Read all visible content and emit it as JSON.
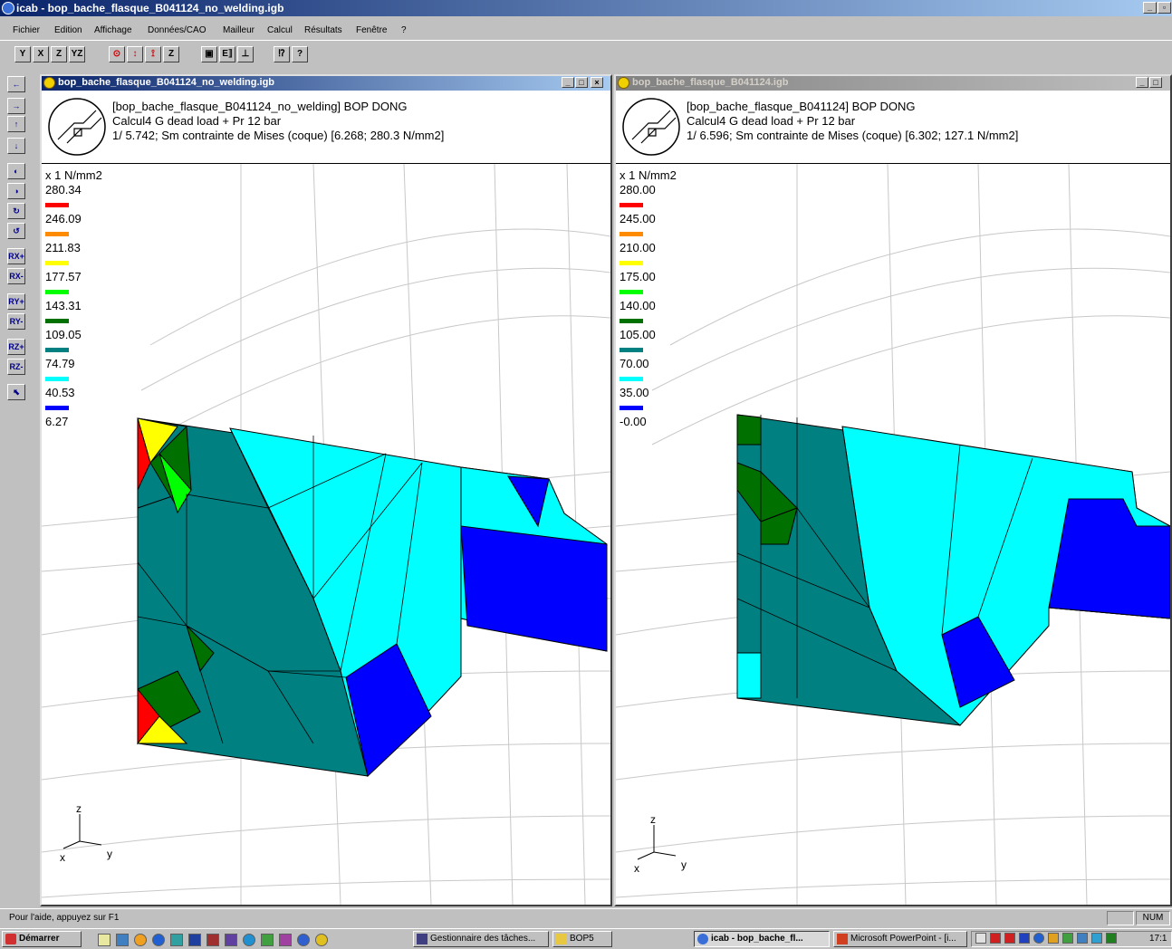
{
  "app": {
    "title": "icab - bop_bache_flasque_B041124_no_welding.igb",
    "menu": [
      "Fichier",
      "Edition",
      "Affichage",
      "Données/CAO",
      "Mailleur",
      "Calcul",
      "Résultats",
      "Fenêtre",
      "?"
    ]
  },
  "toolbar": {
    "buttons": [
      "Y",
      "X",
      "Z",
      "YZ",
      "⊙",
      "↕",
      "⟟",
      "Z",
      "▣",
      "E⟧",
      "⊥",
      "⁉",
      "?"
    ]
  },
  "left_toolbar": {
    "buttons": [
      "←",
      "→",
      "↑",
      "↓",
      "◐",
      "◑",
      "↻",
      "↺",
      "RX+",
      "RX-",
      "RY+",
      "RY-",
      "RZ+",
      "RZ-",
      "⬉"
    ]
  },
  "windows": [
    {
      "title": "bop_bache_flasque_B041124_no_welding.igb",
      "line1": "[bop_bache_flasque_B041124_no_welding] BOP DONG",
      "line2": "Calcul4 G dead load + Pr 12 bar",
      "line3": "1/ 5.742; Sm  contrainte de Mises (coque) [6.268; 280.3 N/mm2]",
      "unit": "x 1 N/mm2",
      "levels": [
        "280.34",
        "246.09",
        "211.83",
        "177.57",
        "143.31",
        "109.05",
        "74.79",
        "40.53",
        "6.27"
      ],
      "axes": {
        "z": "z",
        "x": "x",
        "y": "y"
      }
    },
    {
      "title": "bop_bache_flasque_B041124.igb",
      "line1": "[bop_bache_flasque_B041124] BOP DONG",
      "line2": "Calcul4 G dead load + Pr 12 bar",
      "line3": "1/ 6.596; Sm  contrainte de Mises (coque) [6.302; 127.1 N/mm2]",
      "unit": "x 1 N/mm2",
      "levels": [
        "280.00",
        "245.00",
        "210.00",
        "175.00",
        "140.00",
        "105.00",
        "70.00",
        "35.00",
        "-0.00"
      ],
      "axes": {
        "z": "z",
        "x": "x",
        "y": "y"
      }
    }
  ],
  "legend_colors": [
    "#ff0000",
    "#ff8c00",
    "#ffff00",
    "#00ff00",
    "#007000",
    "#008080",
    "#00ffff",
    "#0000ff"
  ],
  "status": {
    "help": "Pour l'aide, appuyez sur F1",
    "num": "NUM"
  },
  "taskbar": {
    "start": "Démarrer",
    "tasks": [
      "Gestionnaire des tâches...",
      "BOP5",
      "icab - bop_bache_fl...",
      "Microsoft PowerPoint - [i..."
    ],
    "clock": "17:1"
  }
}
